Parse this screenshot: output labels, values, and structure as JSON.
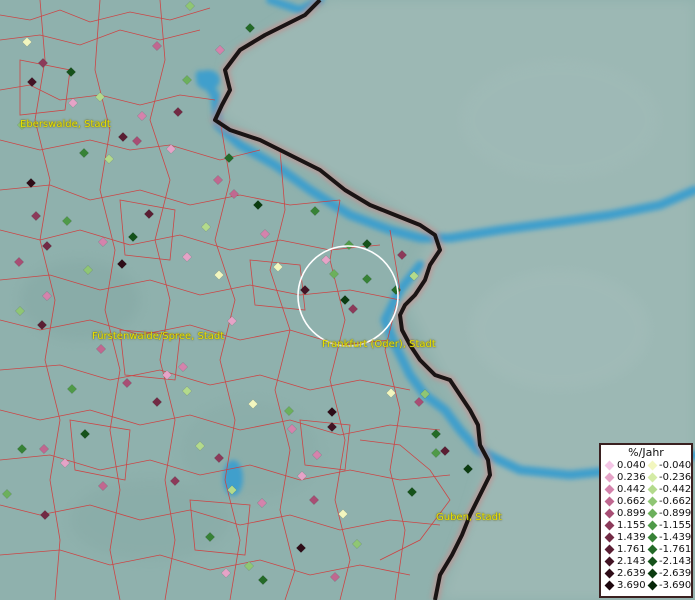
{
  "map": {
    "places": [
      {
        "name": "Eberswalde, Stadt"
      },
      {
        "name": "Fürstenwalde/Spree, Stadt"
      },
      {
        "name": "Frankfurt (Oder), Stadt"
      },
      {
        "name": "Guben, Stadt"
      }
    ],
    "colors": {
      "land": "#8fb1ad",
      "poland": "#9ab6b2",
      "water": "#3f9fcc",
      "border": "#1a1414",
      "admin_lines": "#d23a3a",
      "highlight_circle": "#ffffff"
    }
  },
  "legend": {
    "title": "%/Jahr",
    "positive": [
      {
        "label": "0.040",
        "color": "#f4c6e6"
      },
      {
        "label": "0.236",
        "color": "#e5a3c7"
      },
      {
        "label": "0.442",
        "color": "#d483ac"
      },
      {
        "label": "0.662",
        "color": "#c06890"
      },
      {
        "label": "0.899",
        "color": "#a84e74"
      },
      {
        "label": "1.155",
        "color": "#8c3a5a"
      },
      {
        "label": "1.439",
        "color": "#722a44"
      },
      {
        "label": "1.761",
        "color": "#5a1e33"
      },
      {
        "label": "2.143",
        "color": "#431424"
      },
      {
        "label": "2.639",
        "color": "#2e0c17"
      },
      {
        "label": "3.690",
        "color": "#1c060d"
      }
    ],
    "negative": [
      {
        "label": "-0.040",
        "color": "#f2f6bf"
      },
      {
        "label": "-0.236",
        "color": "#d4eba6"
      },
      {
        "label": "-0.442",
        "color": "#b3da8c"
      },
      {
        "label": "-0.662",
        "color": "#8fc674"
      },
      {
        "label": "-0.899",
        "color": "#6cb05c"
      },
      {
        "label": "-1.155",
        "color": "#4f9a48"
      },
      {
        "label": "-1.439",
        "color": "#378236"
      },
      {
        "label": "-1.761",
        "color": "#236a27"
      },
      {
        "label": "-2.143",
        "color": "#15521a"
      },
      {
        "label": "-2.639",
        "color": "#0b3c10"
      },
      {
        "label": "-3.690",
        "color": "#052608"
      }
    ]
  },
  "stations": [
    {
      "c": "#8fc674"
    },
    {
      "c": "#236a27"
    },
    {
      "c": "#f2f6bf"
    },
    {
      "c": "#c06890"
    },
    {
      "c": "#d483ac"
    },
    {
      "c": "#8c3a5a"
    },
    {
      "c": "#15521a"
    },
    {
      "c": "#b3da8c"
    },
    {
      "c": "#431424"
    },
    {
      "c": "#e5a3c7"
    },
    {
      "c": "#722a44"
    },
    {
      "c": "#6cb05c"
    },
    {
      "c": "#d483ac"
    },
    {
      "c": "#5a1e33"
    },
    {
      "c": "#8fc674"
    },
    {
      "c": "#e5a3c7"
    },
    {
      "c": "#378236"
    },
    {
      "c": "#b3da8c"
    },
    {
      "c": "#2e0c17"
    },
    {
      "c": "#a84e74"
    },
    {
      "c": "#236a27"
    },
    {
      "c": "#c06890"
    },
    {
      "c": "#0b3c10"
    },
    {
      "c": "#d483ac"
    },
    {
      "c": "#8c3a5a"
    },
    {
      "c": "#4f9a48"
    },
    {
      "c": "#f2f6bf"
    },
    {
      "c": "#5a1e33"
    },
    {
      "c": "#e5a3c7"
    },
    {
      "c": "#15521a"
    },
    {
      "c": "#b3da8c"
    },
    {
      "c": "#722a44"
    },
    {
      "c": "#d483ac"
    },
    {
      "c": "#378236"
    },
    {
      "c": "#a84e74"
    },
    {
      "c": "#8fc674"
    },
    {
      "c": "#2e0c17"
    },
    {
      "c": "#e5a3c7"
    },
    {
      "c": "#4f9a48"
    },
    {
      "c": "#c06890"
    },
    {
      "c": "#15521a"
    },
    {
      "c": "#8c3a5a"
    },
    {
      "c": "#f2f6bf"
    },
    {
      "c": "#6cb05c"
    },
    {
      "c": "#431424"
    },
    {
      "c": "#d483ac"
    },
    {
      "c": "#236a27"
    },
    {
      "c": "#b3da8c"
    },
    {
      "c": "#8c3a5a"
    },
    {
      "c": "#e5a3c7"
    },
    {
      "c": "#378236"
    },
    {
      "c": "#5a1e33"
    },
    {
      "c": "#8fc674"
    },
    {
      "c": "#c06890"
    },
    {
      "c": "#0b3c10"
    },
    {
      "c": "#d483ac"
    },
    {
      "c": "#a84e74"
    },
    {
      "c": "#b3da8c"
    },
    {
      "c": "#722a44"
    },
    {
      "c": "#4f9a48"
    },
    {
      "c": "#e5a3c7"
    },
    {
      "c": "#15521a"
    },
    {
      "c": "#f2f6bf"
    },
    {
      "c": "#8c3a5a"
    },
    {
      "c": "#6cb05c"
    },
    {
      "c": "#2e0c17"
    },
    {
      "c": "#d483ac"
    },
    {
      "c": "#378236"
    },
    {
      "c": "#c06890"
    },
    {
      "c": "#b3da8c"
    },
    {
      "c": "#431424"
    },
    {
      "c": "#e5a3c7"
    },
    {
      "c": "#236a27"
    },
    {
      "c": "#8fc674"
    },
    {
      "c": "#a84e74"
    },
    {
      "c": "#f2f6bf"
    },
    {
      "c": "#5a1e33"
    },
    {
      "c": "#4f9a48"
    },
    {
      "c": "#d483ac"
    },
    {
      "c": "#0b3c10"
    },
    {
      "c": "#c06890"
    },
    {
      "c": "#b3da8c"
    },
    {
      "c": "#8c3a5a"
    },
    {
      "c": "#e5a3c7"
    },
    {
      "c": "#15521a"
    },
    {
      "c": "#6cb05c"
    },
    {
      "c": "#722a44"
    },
    {
      "c": "#d483ac"
    },
    {
      "c": "#378236"
    },
    {
      "c": "#f2f6bf"
    },
    {
      "c": "#a84e74"
    },
    {
      "c": "#8fc674"
    },
    {
      "c": "#2e0c17"
    },
    {
      "c": "#e5a3c7"
    },
    {
      "c": "#236a27"
    },
    {
      "c": "#c06890"
    }
  ]
}
